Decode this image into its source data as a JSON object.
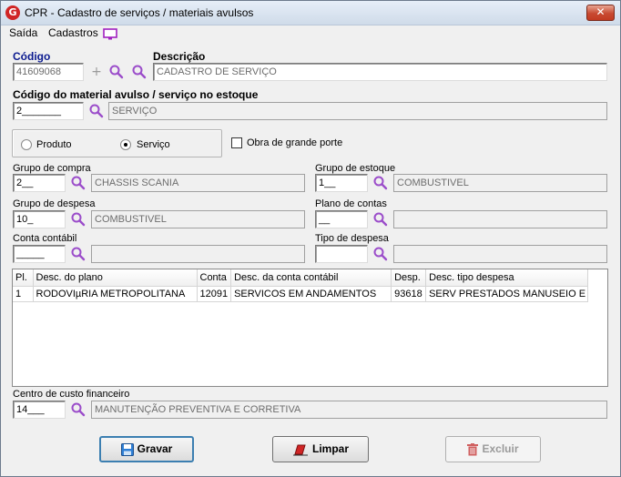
{
  "window": {
    "title": "CPR - Cadastro de serviços / materiais avulsos",
    "close_label": "✕",
    "app_icon_letter": "G"
  },
  "menu": {
    "saida": "Saída",
    "cadastros": "Cadastros"
  },
  "codigo": {
    "label": "Código",
    "value": "41609068"
  },
  "descricao": {
    "label": "Descrição",
    "value": "CADASTRO DE SERVIÇO"
  },
  "material_estoque": {
    "label": "Código do material avulso / serviço no estoque",
    "code": "2_______",
    "desc": "SERVIÇO"
  },
  "tipo": {
    "produto": "Produto",
    "servico": "Serviço",
    "selected": "servico"
  },
  "obra": {
    "label": "Obra de grande porte",
    "checked": false
  },
  "grupo_compra": {
    "label": "Grupo de compra",
    "code": "2__",
    "desc": "CHASSIS SCANIA"
  },
  "grupo_estoque": {
    "label": "Grupo de estoque",
    "code": "1__",
    "desc": "COMBUSTIVEL"
  },
  "grupo_despesa": {
    "label": "Grupo de despesa",
    "code": "10_",
    "desc": "COMBUSTIVEL"
  },
  "plano_contas": {
    "label": "Plano de contas",
    "code": "__",
    "desc": ""
  },
  "conta_contabil": {
    "label": "Conta contábil",
    "code": "_____",
    "desc": ""
  },
  "tipo_despesa": {
    "label": "Tipo de despesa",
    "code": "",
    "desc": ""
  },
  "grid": {
    "headers": [
      "Pl.",
      "Desc. do plano",
      "Conta",
      "Desc. da conta contábil",
      "Desp.",
      "Desc. tipo despesa"
    ],
    "rows": [
      [
        "1",
        "RODOVIµRIA METROPOLITANA",
        "12091",
        "SERVICOS EM ANDAMENTOS",
        "93618",
        "SERV PRESTADOS MANUSEIO E T"
      ]
    ]
  },
  "centro_custo": {
    "label": "Centro de custo financeiro",
    "code": "14___",
    "desc": "MANUTENÇÃO PREVENTIVA E CORRETIVA"
  },
  "buttons": {
    "gravar": "Gravar",
    "limpar": "Limpar",
    "excluir": "Excluir"
  },
  "colors": {
    "accent_blue": "#0b1a8f",
    "search_icon": "#9b4dca",
    "save_icon": "#2e7fd6",
    "clear_icon": "#d02525",
    "delete_icon": "#d06060"
  }
}
